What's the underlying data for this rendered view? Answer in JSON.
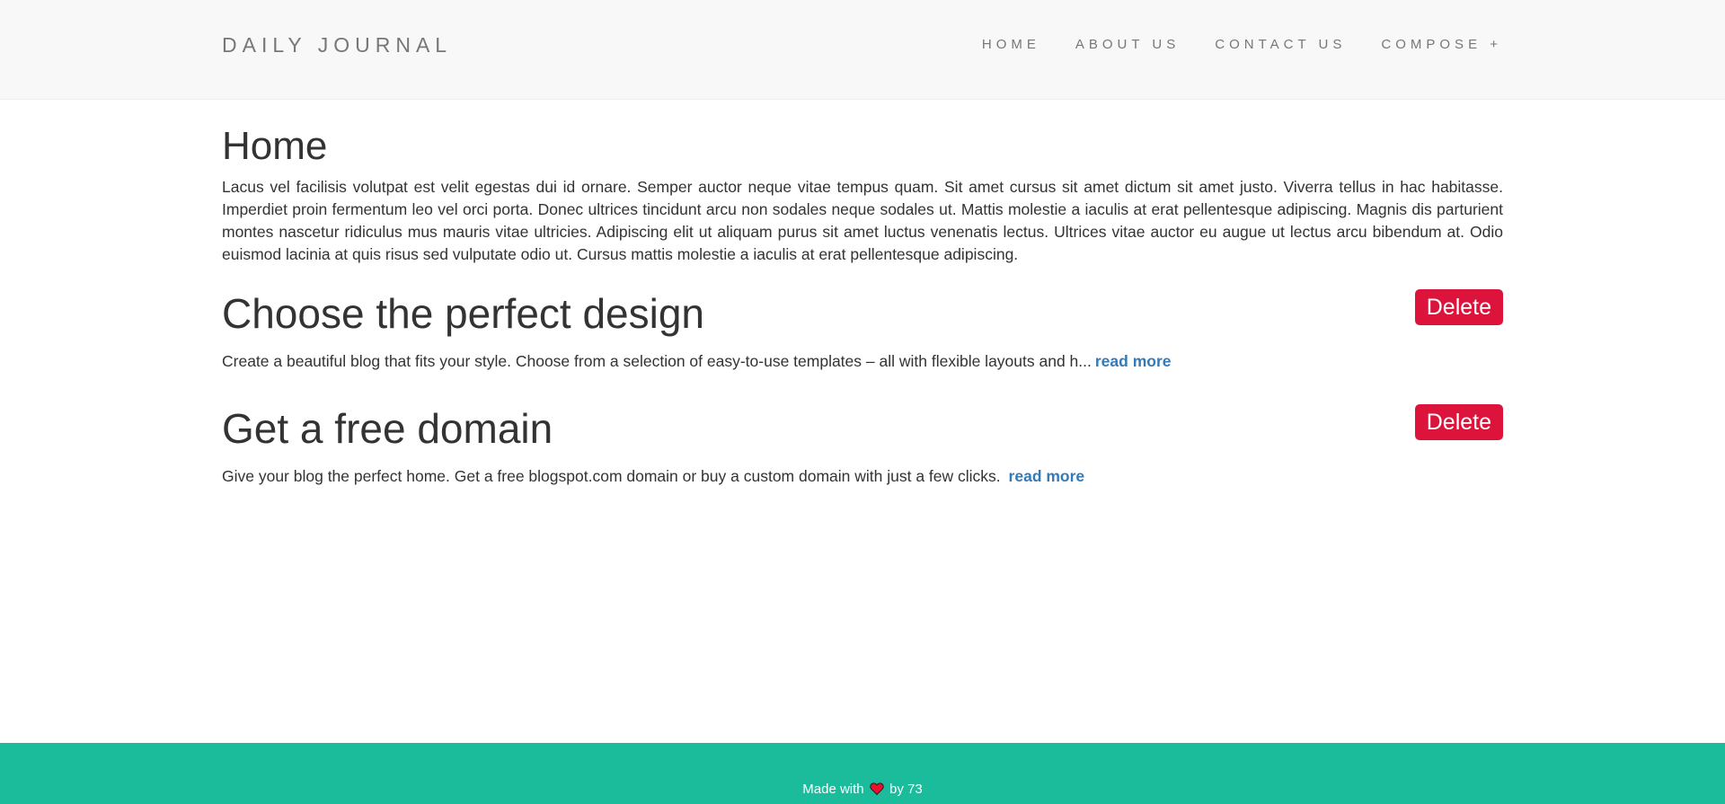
{
  "nav": {
    "brand": "DAILY JOURNAL",
    "items": [
      {
        "label": "HOME"
      },
      {
        "label": "ABOUT US"
      },
      {
        "label": "CONTACT US"
      },
      {
        "label": "COMPOSE +"
      }
    ]
  },
  "main": {
    "title": "Home",
    "intro": "Lacus vel facilisis volutpat est velit egestas dui id ornare. Semper auctor neque vitae tempus quam. Sit amet cursus sit amet dictum sit amet justo. Viverra tellus in hac habitasse. Imperdiet proin fermentum leo vel orci porta. Donec ultrices tincidunt arcu non sodales neque sodales ut. Mattis molestie a iaculis at erat pellentesque adipiscing. Magnis dis parturient montes nascetur ridiculus mus mauris vitae ultricies. Adipiscing elit ut aliquam purus sit amet luctus venenatis lectus. Ultrices vitae auctor eu augue ut lectus arcu bibendum at. Odio euismod lacinia at quis risus sed vulputate odio ut. Cursus mattis molestie a iaculis at erat pellentesque adipiscing.",
    "posts": [
      {
        "title": "Choose the perfect design",
        "excerpt": "Create a beautiful blog that fits your style. Choose from a selection of easy-to-use templates – all with flexible layouts and h...",
        "read_more": "read more",
        "delete_label": "Delete"
      },
      {
        "title": "Get a free domain",
        "excerpt": "Give your blog the perfect home. Get a free blogspot.com domain or buy a custom domain with just a few clicks.",
        "read_more": "read more",
        "delete_label": "Delete"
      }
    ]
  },
  "footer": {
    "prefix": "Made with",
    "suffix": "by 73",
    "heart_icon": "heart-icon",
    "heart_color": "#e8102a"
  },
  "colors": {
    "footer_bg": "#1abc9c",
    "delete_bg": "#dc143c",
    "link": "#337ab7"
  }
}
